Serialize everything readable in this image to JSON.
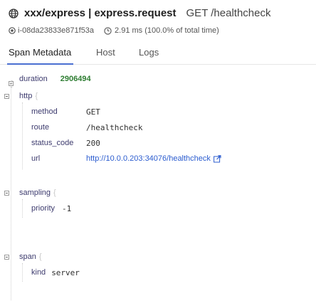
{
  "header": {
    "title": "xxx/express | express.request",
    "resource": "GET /healthcheck",
    "icon": "globe-icon"
  },
  "meta": {
    "host": "i-08da23833e871f53a",
    "duration": "2.91 ms (100.0% of total time)"
  },
  "tabs": [
    {
      "label": "Span Metadata",
      "active": true
    },
    {
      "label": "Host",
      "active": false
    },
    {
      "label": "Logs",
      "active": false
    }
  ],
  "tree": {
    "open_brace": "{",
    "duration": {
      "key": "duration",
      "value": "2906494"
    },
    "http": {
      "key": "http",
      "method": {
        "key": "method",
        "value": "GET"
      },
      "route": {
        "key": "route",
        "value": "/healthcheck"
      },
      "status_code": {
        "key": "status_code",
        "value": "200"
      },
      "url": {
        "key": "url",
        "value": "http://10.0.0.203:34076/healthcheck"
      }
    },
    "sampling": {
      "key": "sampling",
      "priority": {
        "key": "priority",
        "value": "-1"
      }
    },
    "span": {
      "key": "span",
      "kind": {
        "key": "kind",
        "value": "server"
      }
    }
  },
  "colors": {
    "key": "#3d3b6e",
    "number": "#2e7d32",
    "link": "#2b5ccf",
    "tab_underline": "#4a6fd1"
  }
}
